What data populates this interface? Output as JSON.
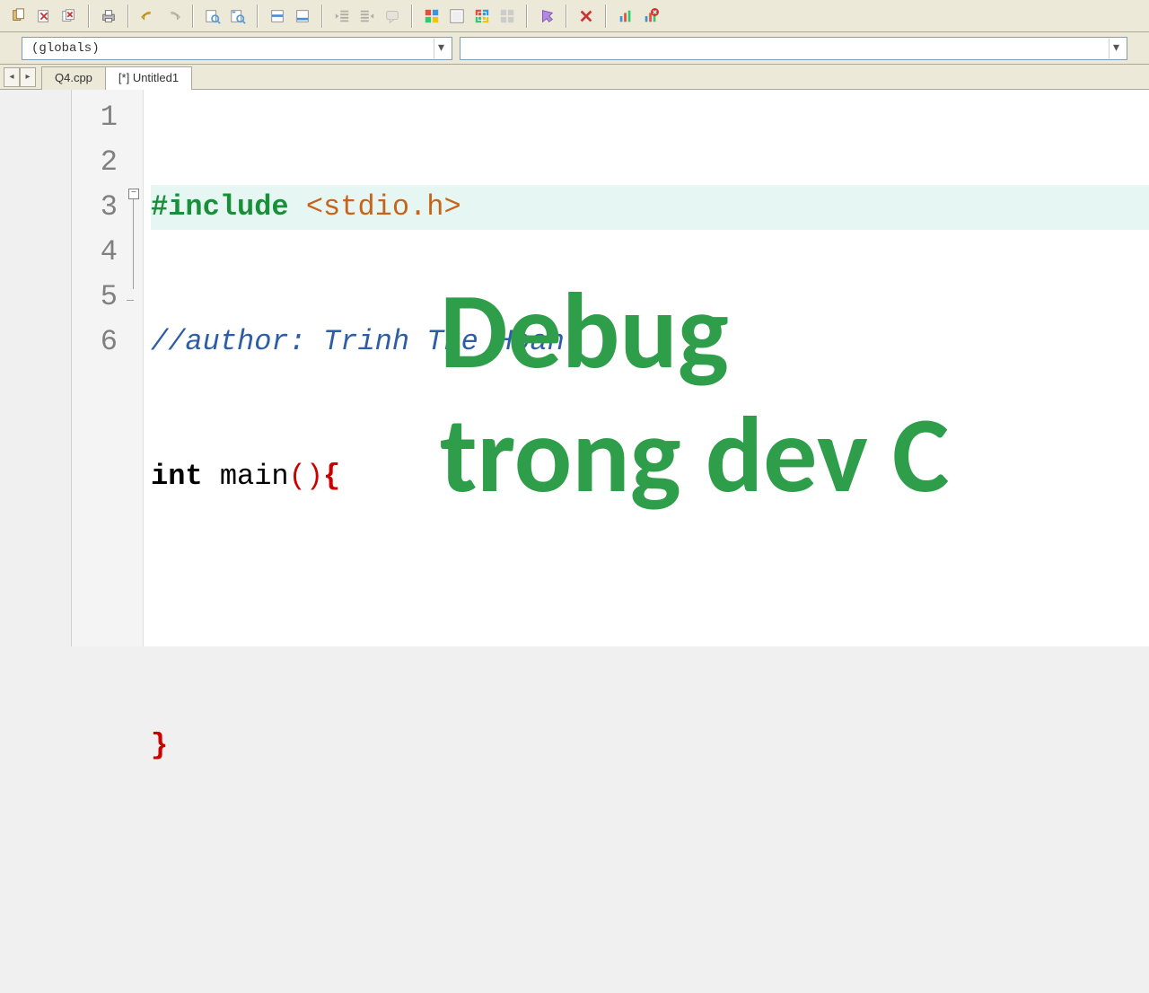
{
  "scope_combo": {
    "text": "(globals)"
  },
  "members_combo": {
    "text": ""
  },
  "tabs": [
    {
      "label": "Q4.cpp",
      "active": false
    },
    {
      "label": "[*] Untitled1",
      "active": true
    }
  ],
  "code": {
    "lines": [
      {
        "n": "1",
        "highlight": true
      },
      {
        "n": "2"
      },
      {
        "n": "3",
        "fold_start": true
      },
      {
        "n": "4"
      },
      {
        "n": "5",
        "fold_end": true
      },
      {
        "n": "6"
      }
    ],
    "line1_pp": "#include",
    "line1_target": "<stdio.h>",
    "line2_comment": "//author: Trinh The Hoan",
    "line3_kw": "int",
    "line3_fn": "main",
    "line3_paren": "()",
    "line3_brace": "{",
    "line5_brace": "}"
  },
  "overlay": {
    "text": "Debug\ntrong dev C"
  }
}
